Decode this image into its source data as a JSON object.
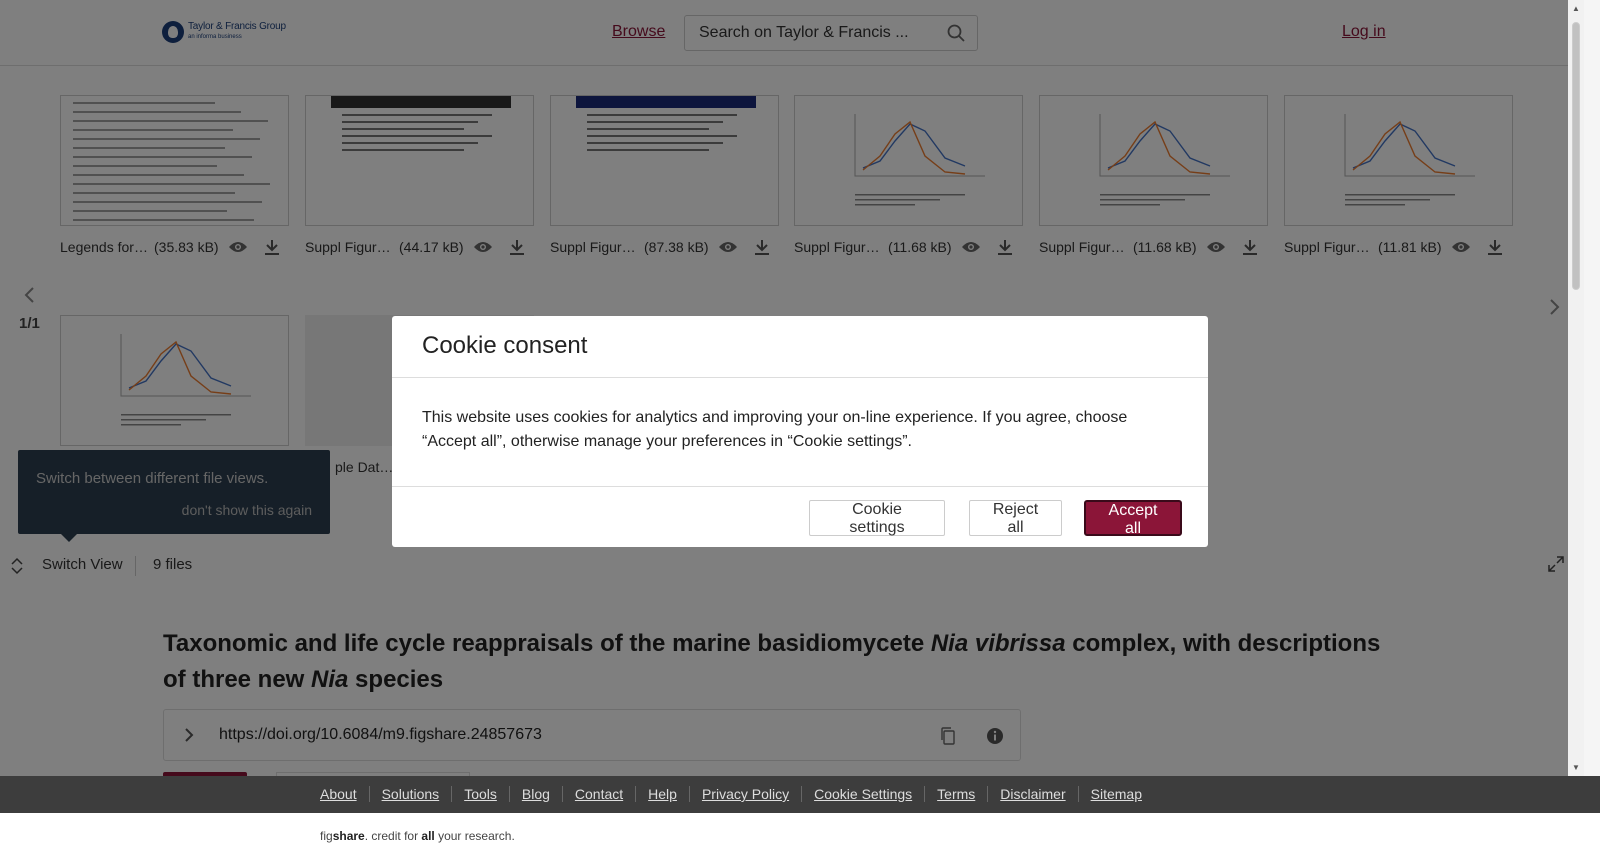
{
  "header": {
    "logo_main": "Taylor & Francis Group",
    "logo_sub": "an informa business",
    "browse_label": "Browse",
    "search_placeholder": "Search on Taylor & Francis ...",
    "login_label": "Log in"
  },
  "viewer": {
    "files": [
      {
        "name": "Legends for…",
        "size": "(35.83 kB)",
        "thumb": "doc"
      },
      {
        "name": "Suppl Figur…",
        "size": "(44.17 kB)",
        "thumb": "photo-caption"
      },
      {
        "name": "Suppl Figur…",
        "size": "(87.38 kB)",
        "thumb": "photo-caption-blue"
      },
      {
        "name": "Suppl Figur…",
        "size": "(11.68 kB)",
        "thumb": "chart"
      },
      {
        "name": "Suppl Figur…",
        "size": "(11.68 kB)",
        "thumb": "chart"
      },
      {
        "name": "Suppl Figur…",
        "size": "(11.81 kB)",
        "thumb": "chart"
      },
      {
        "name": "",
        "size": "",
        "thumb": "chart"
      },
      {
        "name": "ple Dat…",
        "size": "",
        "thumb": "blank"
      }
    ],
    "page_indicator": "1/1",
    "switch_view_label": "Switch View",
    "files_count": "9 files",
    "tooltip_text": "Switch between different file views.",
    "tooltip_link": "don't show this again"
  },
  "article": {
    "title_part1": "Taxonomic and life cycle reappraisals of the marine basidiomycete ",
    "title_italic1": "Nia vibrissa",
    "title_part2": " complex, with descriptions of three new ",
    "title_italic2": "Nia",
    "title_part3": " species",
    "doi": "https://doi.org/10.6084/m9.figshare.24857673"
  },
  "cookie_modal": {
    "title": "Cookie consent",
    "body": "This website uses cookies for analytics and improving your on-line experience. If you agree, choose “Accept all”, otherwise manage your preferences in “Cookie settings”.",
    "settings_label": "Cookie settings",
    "reject_label": "Reject all",
    "accept_label": "Accept all"
  },
  "footer": {
    "links": [
      "About",
      "Solutions",
      "Tools",
      "Blog",
      "Contact",
      "Help",
      "Privacy Policy",
      "Cookie Settings",
      "Terms",
      "Disclaimer",
      "Sitemap"
    ],
    "credit_fig": "fig",
    "credit_share": "share",
    "credit_mid": ". credit for ",
    "credit_all": "all",
    "credit_end": " your research."
  },
  "colors": {
    "brand": "#8b1538",
    "footer_bg": "#3d3d3d",
    "tooltip_bg": "#2c3e50"
  },
  "icons": [
    "search-icon",
    "eye-icon",
    "download-icon",
    "chevron-left-icon",
    "chevron-right-icon",
    "switch-view-icon",
    "expand-icon",
    "chevron-right-icon",
    "copy-icon",
    "info-icon"
  ]
}
